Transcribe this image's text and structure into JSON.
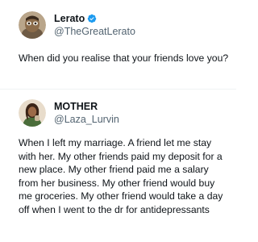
{
  "tweets": [
    {
      "display_name": "Lerato",
      "verified": true,
      "handle": "@TheGreatLerato",
      "text": "When did you realise that your friends love you?"
    },
    {
      "display_name": "MOTHER",
      "verified": false,
      "handle": "@Laza_Lurvin",
      "text": "When I left my marriage. A friend let me stay with her. My other friends paid my deposit for a new place. My other friend paid me a salary from her business. My other friend would buy me groceries. My other friend  would take a day off when I went to the dr for antidepressants"
    }
  ],
  "colors": {
    "verified": "#1d9bf0",
    "text": "#0f1419",
    "secondary": "#536471",
    "divider": "#eff3f4"
  }
}
